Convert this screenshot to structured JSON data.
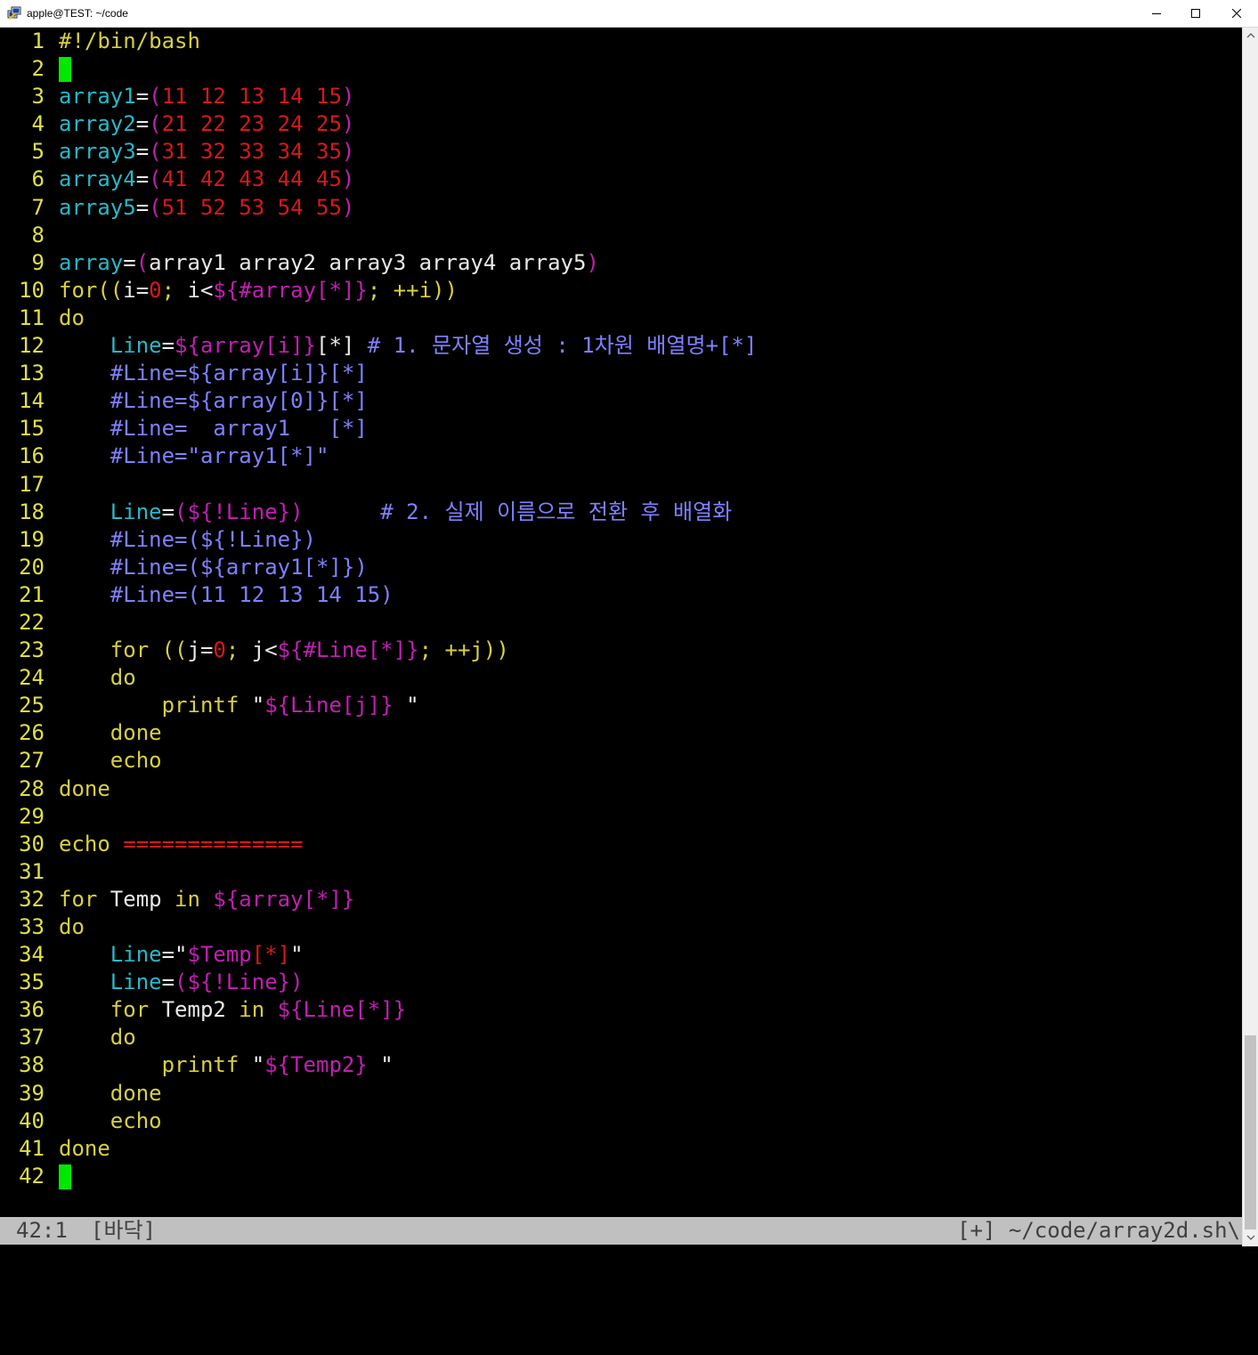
{
  "window": {
    "title": "apple@TEST: ~/code"
  },
  "editor": {
    "lines": [
      {
        "n": "1",
        "segs": [
          [
            "kw",
            "#!/bin/bash"
          ]
        ]
      },
      {
        "n": "2",
        "segs": [],
        "cursor": true
      },
      {
        "n": "3",
        "segs": [
          [
            "var",
            "array1"
          ],
          [
            "op",
            "="
          ],
          [
            "mag",
            "("
          ],
          [
            "num",
            "11 12 13 14 15"
          ],
          [
            "mag",
            ")"
          ]
        ]
      },
      {
        "n": "4",
        "segs": [
          [
            "var",
            "array2"
          ],
          [
            "op",
            "="
          ],
          [
            "mag",
            "("
          ],
          [
            "num",
            "21 22 23 24 25"
          ],
          [
            "mag",
            ")"
          ]
        ]
      },
      {
        "n": "5",
        "segs": [
          [
            "var",
            "array3"
          ],
          [
            "op",
            "="
          ],
          [
            "mag",
            "("
          ],
          [
            "num",
            "31 32 33 34 35"
          ],
          [
            "mag",
            ")"
          ]
        ]
      },
      {
        "n": "6",
        "segs": [
          [
            "var",
            "array4"
          ],
          [
            "op",
            "="
          ],
          [
            "mag",
            "("
          ],
          [
            "num",
            "41 42 43 44 45"
          ],
          [
            "mag",
            ")"
          ]
        ]
      },
      {
        "n": "7",
        "segs": [
          [
            "var",
            "array5"
          ],
          [
            "op",
            "="
          ],
          [
            "mag",
            "("
          ],
          [
            "num",
            "51 52 53 54 55"
          ],
          [
            "mag",
            ")"
          ]
        ]
      },
      {
        "n": "8",
        "segs": []
      },
      {
        "n": "9",
        "segs": [
          [
            "var",
            "array"
          ],
          [
            "op",
            "="
          ],
          [
            "mag",
            "("
          ],
          [
            "def",
            "array1 array2 array3 array4 array5"
          ],
          [
            "mag",
            ")"
          ]
        ]
      },
      {
        "n": "10",
        "segs": [
          [
            "kw",
            "for(("
          ],
          [
            "def",
            "i="
          ],
          [
            "num",
            "0"
          ],
          [
            "kw",
            "; "
          ],
          [
            "def",
            "i<"
          ],
          [
            "mag",
            "${#array[*]}"
          ],
          [
            "kw",
            "; ++i))"
          ]
        ]
      },
      {
        "n": "11",
        "segs": [
          [
            "kw",
            "do"
          ]
        ]
      },
      {
        "n": "12",
        "segs": [
          [
            "def",
            "    "
          ],
          [
            "var",
            "Line"
          ],
          [
            "op",
            "="
          ],
          [
            "mag",
            "${array[i]}"
          ],
          [
            "def",
            "[*] "
          ],
          [
            "com",
            "# 1. 문자열 생성 : 1차원 배열명+[*]"
          ]
        ]
      },
      {
        "n": "13",
        "segs": [
          [
            "def",
            "    "
          ],
          [
            "com",
            "#Line=${array[i]}[*]"
          ]
        ]
      },
      {
        "n": "14",
        "segs": [
          [
            "def",
            "    "
          ],
          [
            "com",
            "#Line=${array[0]}[*]"
          ]
        ]
      },
      {
        "n": "15",
        "segs": [
          [
            "def",
            "    "
          ],
          [
            "com",
            "#Line=  array1   [*]"
          ]
        ]
      },
      {
        "n": "16",
        "segs": [
          [
            "def",
            "    "
          ],
          [
            "com",
            "#Line=\"array1[*]\""
          ]
        ]
      },
      {
        "n": "17",
        "segs": []
      },
      {
        "n": "18",
        "segs": [
          [
            "def",
            "    "
          ],
          [
            "var",
            "Line"
          ],
          [
            "op",
            "="
          ],
          [
            "mag",
            "(${!Line})"
          ],
          [
            "def",
            "      "
          ],
          [
            "com",
            "# 2. 실제 이름으로 전환 후 배열화"
          ]
        ]
      },
      {
        "n": "19",
        "segs": [
          [
            "def",
            "    "
          ],
          [
            "com",
            "#Line=(${!Line})"
          ]
        ]
      },
      {
        "n": "20",
        "segs": [
          [
            "def",
            "    "
          ],
          [
            "com",
            "#Line=(${array1[*]})"
          ]
        ]
      },
      {
        "n": "21",
        "segs": [
          [
            "def",
            "    "
          ],
          [
            "com",
            "#Line=(11 12 13 14 15)"
          ]
        ]
      },
      {
        "n": "22",
        "segs": []
      },
      {
        "n": "23",
        "segs": [
          [
            "def",
            "    "
          ],
          [
            "kw",
            "for (("
          ],
          [
            "def",
            "j="
          ],
          [
            "num",
            "0"
          ],
          [
            "kw",
            "; "
          ],
          [
            "def",
            "j<"
          ],
          [
            "mag",
            "${#Line[*]}"
          ],
          [
            "kw",
            "; ++j))"
          ]
        ]
      },
      {
        "n": "24",
        "segs": [
          [
            "def",
            "    "
          ],
          [
            "kw",
            "do"
          ]
        ]
      },
      {
        "n": "25",
        "segs": [
          [
            "def",
            "        "
          ],
          [
            "kw",
            "printf "
          ],
          [
            "op",
            "\""
          ],
          [
            "mag",
            "${Line[j]}"
          ],
          [
            "op",
            " \""
          ]
        ]
      },
      {
        "n": "26",
        "segs": [
          [
            "def",
            "    "
          ],
          [
            "kw",
            "done"
          ]
        ]
      },
      {
        "n": "27",
        "segs": [
          [
            "def",
            "    "
          ],
          [
            "kw",
            "echo"
          ]
        ]
      },
      {
        "n": "28",
        "segs": [
          [
            "kw",
            "done"
          ]
        ]
      },
      {
        "n": "29",
        "segs": []
      },
      {
        "n": "30",
        "segs": [
          [
            "kw",
            "echo "
          ],
          [
            "num",
            "=============="
          ]
        ]
      },
      {
        "n": "31",
        "segs": []
      },
      {
        "n": "32",
        "segs": [
          [
            "kw",
            "for "
          ],
          [
            "def",
            "Temp "
          ],
          [
            "kw",
            "in "
          ],
          [
            "mag",
            "${array[*]}"
          ]
        ]
      },
      {
        "n": "33",
        "segs": [
          [
            "kw",
            "do"
          ]
        ]
      },
      {
        "n": "34",
        "segs": [
          [
            "def",
            "    "
          ],
          [
            "var",
            "Line"
          ],
          [
            "op",
            "=\""
          ],
          [
            "mag",
            "$Temp"
          ],
          [
            "num",
            "[*]"
          ],
          [
            "op",
            "\""
          ]
        ]
      },
      {
        "n": "35",
        "segs": [
          [
            "def",
            "    "
          ],
          [
            "var",
            "Line"
          ],
          [
            "op",
            "="
          ],
          [
            "mag",
            "(${!Line})"
          ]
        ]
      },
      {
        "n": "36",
        "segs": [
          [
            "def",
            "    "
          ],
          [
            "kw",
            "for "
          ],
          [
            "def",
            "Temp2 "
          ],
          [
            "kw",
            "in "
          ],
          [
            "mag",
            "${Line[*]}"
          ]
        ]
      },
      {
        "n": "37",
        "segs": [
          [
            "def",
            "    "
          ],
          [
            "kw",
            "do"
          ]
        ]
      },
      {
        "n": "38",
        "segs": [
          [
            "def",
            "        "
          ],
          [
            "kw",
            "printf "
          ],
          [
            "op",
            "\""
          ],
          [
            "mag",
            "${Temp2}"
          ],
          [
            "op",
            " \""
          ]
        ]
      },
      {
        "n": "39",
        "segs": [
          [
            "def",
            "    "
          ],
          [
            "kw",
            "done"
          ]
        ]
      },
      {
        "n": "40",
        "segs": [
          [
            "def",
            "    "
          ],
          [
            "kw",
            "echo"
          ]
        ]
      },
      {
        "n": "41",
        "segs": [
          [
            "kw",
            "done"
          ]
        ]
      },
      {
        "n": "42",
        "segs": [],
        "cursor": true
      }
    ]
  },
  "status": {
    "position": "42:1",
    "mode": "[바닥]",
    "file": "[+] ~/code/array2d.sh\\"
  }
}
